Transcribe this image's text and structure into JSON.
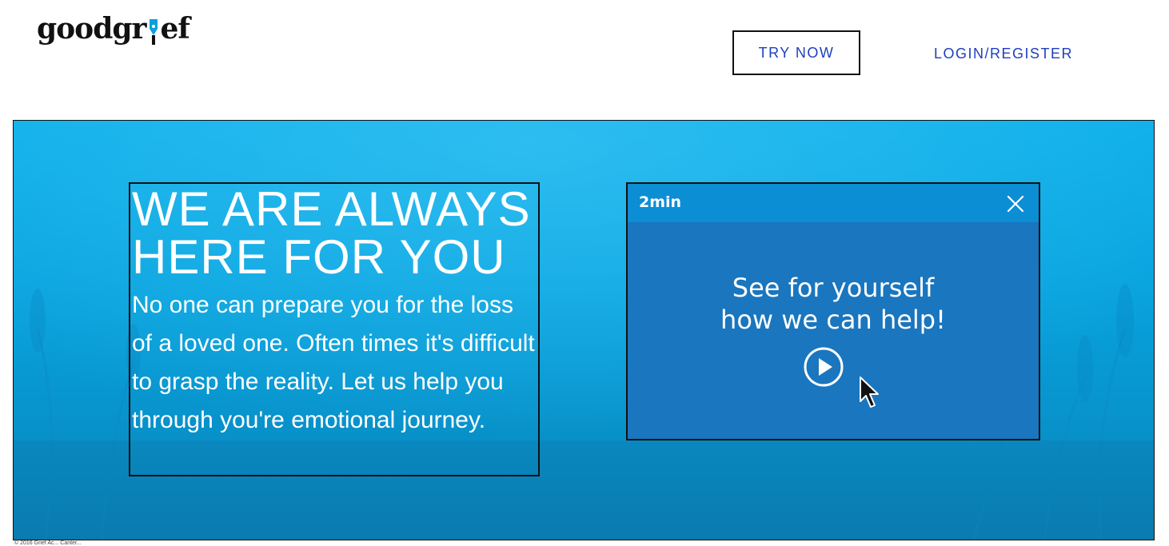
{
  "header": {
    "logo_text_left": "goodgr",
    "logo_text_right": "ef",
    "try_now_label": "TRY NOW",
    "login_label": "LOGIN/REGISTER"
  },
  "hero": {
    "headline_line1": "WE ARE ALWAYS",
    "headline_line2": "HERE FOR YOU",
    "body": "No one can prepare you for the loss of a loved one. Often times it's difficult to grasp the reality. Let us help you through you're emotional journey."
  },
  "video": {
    "duration": "2min",
    "cta_line1": "See for yourself",
    "cta_line2": "how we can help!",
    "close_icon": "close-icon",
    "play_icon": "play-icon"
  },
  "footer": {
    "copyright": "© 2016 Grief Ac... Canter..."
  },
  "colors": {
    "link": "#1d3fbf",
    "hero_blue": "#07a2de",
    "video_bg": "#1a76be",
    "video_bar": "#0b8ed4"
  }
}
